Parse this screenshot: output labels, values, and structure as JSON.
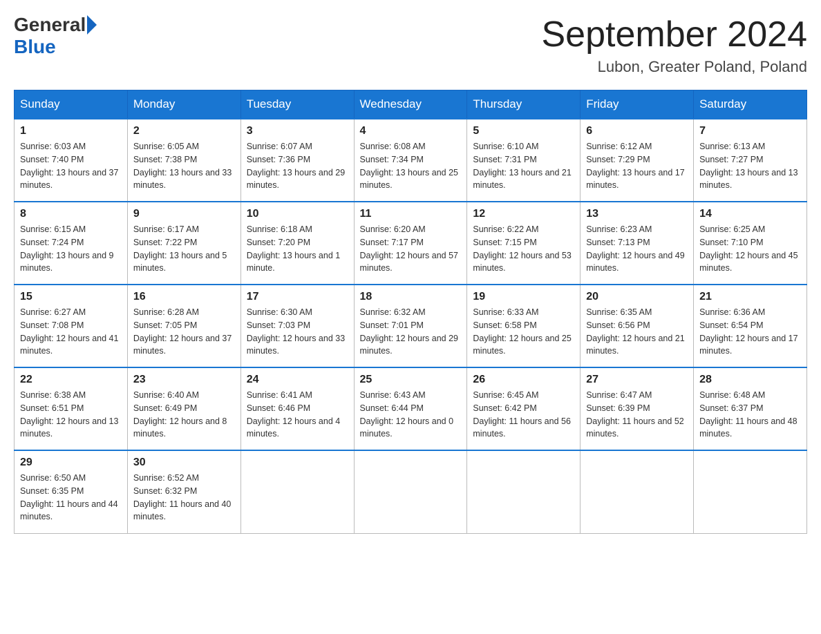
{
  "header": {
    "logo_general": "General",
    "logo_blue": "Blue",
    "month_title": "September 2024",
    "location": "Lubon, Greater Poland, Poland"
  },
  "days_of_week": [
    "Sunday",
    "Monday",
    "Tuesday",
    "Wednesday",
    "Thursday",
    "Friday",
    "Saturday"
  ],
  "weeks": [
    [
      {
        "day": "1",
        "sunrise": "6:03 AM",
        "sunset": "7:40 PM",
        "daylight": "13 hours and 37 minutes."
      },
      {
        "day": "2",
        "sunrise": "6:05 AM",
        "sunset": "7:38 PM",
        "daylight": "13 hours and 33 minutes."
      },
      {
        "day": "3",
        "sunrise": "6:07 AM",
        "sunset": "7:36 PM",
        "daylight": "13 hours and 29 minutes."
      },
      {
        "day": "4",
        "sunrise": "6:08 AM",
        "sunset": "7:34 PM",
        "daylight": "13 hours and 25 minutes."
      },
      {
        "day": "5",
        "sunrise": "6:10 AM",
        "sunset": "7:31 PM",
        "daylight": "13 hours and 21 minutes."
      },
      {
        "day": "6",
        "sunrise": "6:12 AM",
        "sunset": "7:29 PM",
        "daylight": "13 hours and 17 minutes."
      },
      {
        "day": "7",
        "sunrise": "6:13 AM",
        "sunset": "7:27 PM",
        "daylight": "13 hours and 13 minutes."
      }
    ],
    [
      {
        "day": "8",
        "sunrise": "6:15 AM",
        "sunset": "7:24 PM",
        "daylight": "13 hours and 9 minutes."
      },
      {
        "day": "9",
        "sunrise": "6:17 AM",
        "sunset": "7:22 PM",
        "daylight": "13 hours and 5 minutes."
      },
      {
        "day": "10",
        "sunrise": "6:18 AM",
        "sunset": "7:20 PM",
        "daylight": "13 hours and 1 minute."
      },
      {
        "day": "11",
        "sunrise": "6:20 AM",
        "sunset": "7:17 PM",
        "daylight": "12 hours and 57 minutes."
      },
      {
        "day": "12",
        "sunrise": "6:22 AM",
        "sunset": "7:15 PM",
        "daylight": "12 hours and 53 minutes."
      },
      {
        "day": "13",
        "sunrise": "6:23 AM",
        "sunset": "7:13 PM",
        "daylight": "12 hours and 49 minutes."
      },
      {
        "day": "14",
        "sunrise": "6:25 AM",
        "sunset": "7:10 PM",
        "daylight": "12 hours and 45 minutes."
      }
    ],
    [
      {
        "day": "15",
        "sunrise": "6:27 AM",
        "sunset": "7:08 PM",
        "daylight": "12 hours and 41 minutes."
      },
      {
        "day": "16",
        "sunrise": "6:28 AM",
        "sunset": "7:05 PM",
        "daylight": "12 hours and 37 minutes."
      },
      {
        "day": "17",
        "sunrise": "6:30 AM",
        "sunset": "7:03 PM",
        "daylight": "12 hours and 33 minutes."
      },
      {
        "day": "18",
        "sunrise": "6:32 AM",
        "sunset": "7:01 PM",
        "daylight": "12 hours and 29 minutes."
      },
      {
        "day": "19",
        "sunrise": "6:33 AM",
        "sunset": "6:58 PM",
        "daylight": "12 hours and 25 minutes."
      },
      {
        "day": "20",
        "sunrise": "6:35 AM",
        "sunset": "6:56 PM",
        "daylight": "12 hours and 21 minutes."
      },
      {
        "day": "21",
        "sunrise": "6:36 AM",
        "sunset": "6:54 PM",
        "daylight": "12 hours and 17 minutes."
      }
    ],
    [
      {
        "day": "22",
        "sunrise": "6:38 AM",
        "sunset": "6:51 PM",
        "daylight": "12 hours and 13 minutes."
      },
      {
        "day": "23",
        "sunrise": "6:40 AM",
        "sunset": "6:49 PM",
        "daylight": "12 hours and 8 minutes."
      },
      {
        "day": "24",
        "sunrise": "6:41 AM",
        "sunset": "6:46 PM",
        "daylight": "12 hours and 4 minutes."
      },
      {
        "day": "25",
        "sunrise": "6:43 AM",
        "sunset": "6:44 PM",
        "daylight": "12 hours and 0 minutes."
      },
      {
        "day": "26",
        "sunrise": "6:45 AM",
        "sunset": "6:42 PM",
        "daylight": "11 hours and 56 minutes."
      },
      {
        "day": "27",
        "sunrise": "6:47 AM",
        "sunset": "6:39 PM",
        "daylight": "11 hours and 52 minutes."
      },
      {
        "day": "28",
        "sunrise": "6:48 AM",
        "sunset": "6:37 PM",
        "daylight": "11 hours and 48 minutes."
      }
    ],
    [
      {
        "day": "29",
        "sunrise": "6:50 AM",
        "sunset": "6:35 PM",
        "daylight": "11 hours and 44 minutes."
      },
      {
        "day": "30",
        "sunrise": "6:52 AM",
        "sunset": "6:32 PM",
        "daylight": "11 hours and 40 minutes."
      },
      null,
      null,
      null,
      null,
      null
    ]
  ]
}
